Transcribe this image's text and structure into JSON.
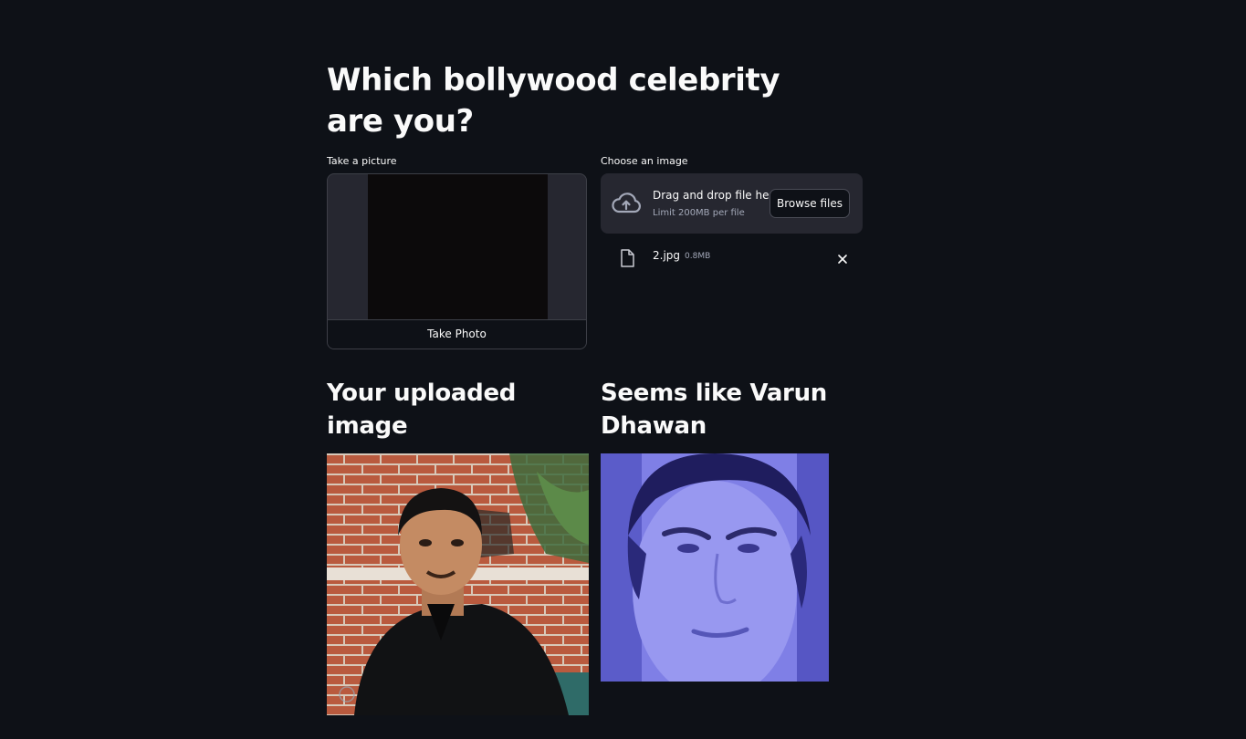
{
  "page": {
    "title": "Which bollywood celebrity are you?"
  },
  "camera": {
    "label": "Take a picture",
    "button_label": "Take Photo"
  },
  "uploader": {
    "label": "Choose an image",
    "drop_text": "Drag and drop file here",
    "limit_text": "Limit 200MB per file",
    "browse_label": "Browse files",
    "file": {
      "name": "2.jpg",
      "size": "0.8MB"
    }
  },
  "results": {
    "uploaded_heading": "Your uploaded image",
    "match_heading": "Seems like Varun Dhawan"
  },
  "icons": {
    "upload": "cloud-upload-icon",
    "file": "file-icon",
    "remove": "close-icon"
  },
  "colors": {
    "background": "#0e1117",
    "widget": "#262730",
    "text": "#fafafa",
    "muted": "#a3a8b8"
  }
}
